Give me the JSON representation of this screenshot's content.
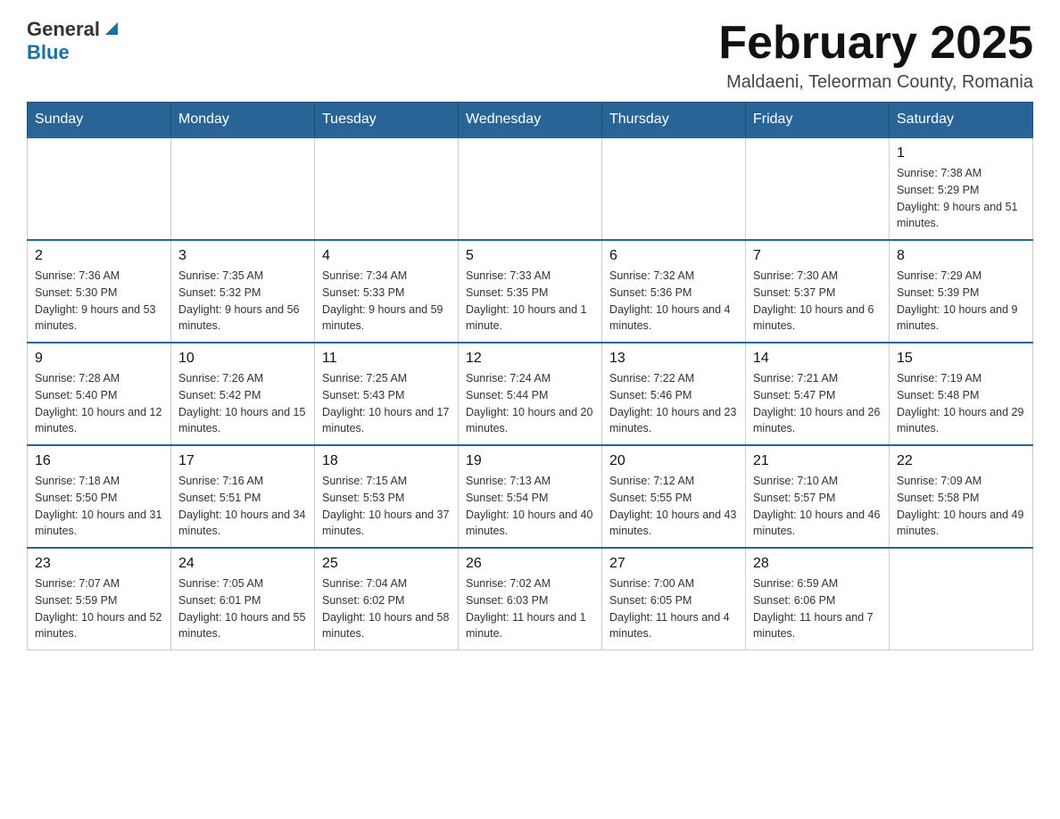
{
  "header": {
    "logo_general": "General",
    "logo_blue": "Blue",
    "month_title": "February 2025",
    "location": "Maldaeni, Teleorman County, Romania"
  },
  "weekdays": [
    "Sunday",
    "Monday",
    "Tuesday",
    "Wednesday",
    "Thursday",
    "Friday",
    "Saturday"
  ],
  "weeks": [
    [
      {
        "day": "",
        "info": ""
      },
      {
        "day": "",
        "info": ""
      },
      {
        "day": "",
        "info": ""
      },
      {
        "day": "",
        "info": ""
      },
      {
        "day": "",
        "info": ""
      },
      {
        "day": "",
        "info": ""
      },
      {
        "day": "1",
        "info": "Sunrise: 7:38 AM\nSunset: 5:29 PM\nDaylight: 9 hours and 51 minutes."
      }
    ],
    [
      {
        "day": "2",
        "info": "Sunrise: 7:36 AM\nSunset: 5:30 PM\nDaylight: 9 hours and 53 minutes."
      },
      {
        "day": "3",
        "info": "Sunrise: 7:35 AM\nSunset: 5:32 PM\nDaylight: 9 hours and 56 minutes."
      },
      {
        "day": "4",
        "info": "Sunrise: 7:34 AM\nSunset: 5:33 PM\nDaylight: 9 hours and 59 minutes."
      },
      {
        "day": "5",
        "info": "Sunrise: 7:33 AM\nSunset: 5:35 PM\nDaylight: 10 hours and 1 minute."
      },
      {
        "day": "6",
        "info": "Sunrise: 7:32 AM\nSunset: 5:36 PM\nDaylight: 10 hours and 4 minutes."
      },
      {
        "day": "7",
        "info": "Sunrise: 7:30 AM\nSunset: 5:37 PM\nDaylight: 10 hours and 6 minutes."
      },
      {
        "day": "8",
        "info": "Sunrise: 7:29 AM\nSunset: 5:39 PM\nDaylight: 10 hours and 9 minutes."
      }
    ],
    [
      {
        "day": "9",
        "info": "Sunrise: 7:28 AM\nSunset: 5:40 PM\nDaylight: 10 hours and 12 minutes."
      },
      {
        "day": "10",
        "info": "Sunrise: 7:26 AM\nSunset: 5:42 PM\nDaylight: 10 hours and 15 minutes."
      },
      {
        "day": "11",
        "info": "Sunrise: 7:25 AM\nSunset: 5:43 PM\nDaylight: 10 hours and 17 minutes."
      },
      {
        "day": "12",
        "info": "Sunrise: 7:24 AM\nSunset: 5:44 PM\nDaylight: 10 hours and 20 minutes."
      },
      {
        "day": "13",
        "info": "Sunrise: 7:22 AM\nSunset: 5:46 PM\nDaylight: 10 hours and 23 minutes."
      },
      {
        "day": "14",
        "info": "Sunrise: 7:21 AM\nSunset: 5:47 PM\nDaylight: 10 hours and 26 minutes."
      },
      {
        "day": "15",
        "info": "Sunrise: 7:19 AM\nSunset: 5:48 PM\nDaylight: 10 hours and 29 minutes."
      }
    ],
    [
      {
        "day": "16",
        "info": "Sunrise: 7:18 AM\nSunset: 5:50 PM\nDaylight: 10 hours and 31 minutes."
      },
      {
        "day": "17",
        "info": "Sunrise: 7:16 AM\nSunset: 5:51 PM\nDaylight: 10 hours and 34 minutes."
      },
      {
        "day": "18",
        "info": "Sunrise: 7:15 AM\nSunset: 5:53 PM\nDaylight: 10 hours and 37 minutes."
      },
      {
        "day": "19",
        "info": "Sunrise: 7:13 AM\nSunset: 5:54 PM\nDaylight: 10 hours and 40 minutes."
      },
      {
        "day": "20",
        "info": "Sunrise: 7:12 AM\nSunset: 5:55 PM\nDaylight: 10 hours and 43 minutes."
      },
      {
        "day": "21",
        "info": "Sunrise: 7:10 AM\nSunset: 5:57 PM\nDaylight: 10 hours and 46 minutes."
      },
      {
        "day": "22",
        "info": "Sunrise: 7:09 AM\nSunset: 5:58 PM\nDaylight: 10 hours and 49 minutes."
      }
    ],
    [
      {
        "day": "23",
        "info": "Sunrise: 7:07 AM\nSunset: 5:59 PM\nDaylight: 10 hours and 52 minutes."
      },
      {
        "day": "24",
        "info": "Sunrise: 7:05 AM\nSunset: 6:01 PM\nDaylight: 10 hours and 55 minutes."
      },
      {
        "day": "25",
        "info": "Sunrise: 7:04 AM\nSunset: 6:02 PM\nDaylight: 10 hours and 58 minutes."
      },
      {
        "day": "26",
        "info": "Sunrise: 7:02 AM\nSunset: 6:03 PM\nDaylight: 11 hours and 1 minute."
      },
      {
        "day": "27",
        "info": "Sunrise: 7:00 AM\nSunset: 6:05 PM\nDaylight: 11 hours and 4 minutes."
      },
      {
        "day": "28",
        "info": "Sunrise: 6:59 AM\nSunset: 6:06 PM\nDaylight: 11 hours and 7 minutes."
      },
      {
        "day": "",
        "info": ""
      }
    ]
  ]
}
